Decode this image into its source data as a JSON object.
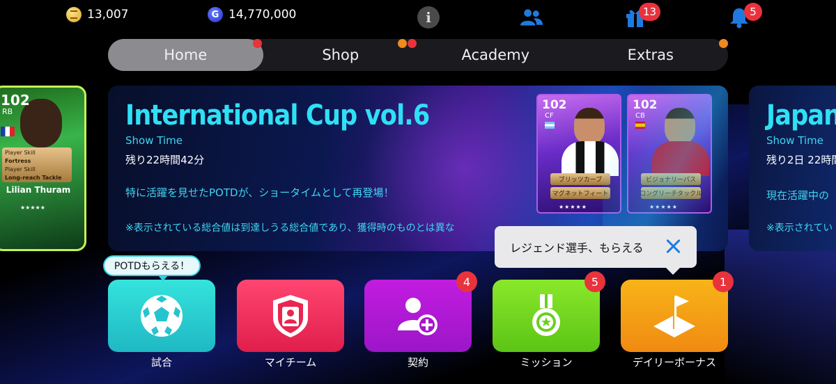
{
  "currencies": {
    "coins": "13,007",
    "gp": "14,770,000",
    "gp_icon_letter": "G"
  },
  "top_icons": {
    "info": "i",
    "gift_badge": "13",
    "bell_badge": "5"
  },
  "nav": {
    "tabs": [
      {
        "label": "Home",
        "active": true
      },
      {
        "label": "Shop",
        "active": false
      },
      {
        "label": "Academy",
        "active": false
      },
      {
        "label": "Extras",
        "active": false
      }
    ]
  },
  "left_card": {
    "rating": "102",
    "position": "RB",
    "skill_1_title": "Player Skill",
    "skill_1": "Fortress",
    "skill_2_title": "Player Skill",
    "skill_2": "Long-reach Tackle",
    "player_name": "Lilian Thuram",
    "stars": "★★★★★"
  },
  "main_card": {
    "title": "International Cup vol.6",
    "subtitle": "Show Time",
    "time_left": "残り22時間42分",
    "description": "特に活躍を見せたPOTDが、ショータイムとして再登場！",
    "note": "※表示されている総合値は到達しうる総合値であり、獲得時のものとは異な",
    "players": [
      {
        "rating": "102",
        "position": "CF",
        "skill_1": "ブリッツカーブ",
        "skill_2": "マグネットフィート",
        "stars": "★★★★★"
      },
      {
        "rating": "102",
        "position": "CB",
        "skill_1": "ビジョナリーパス",
        "skill_2": "ロングリーチタックル",
        "stars": "★★★★★"
      }
    ]
  },
  "right_card": {
    "title": "Japan",
    "subtitle": "Show Time",
    "time_left": "残り2日 22時間",
    "description": "現在活躍中の",
    "note": "※表示されてい"
  },
  "tooltips": {
    "potd": "POTDもらえる！",
    "legend": "レジェンド選手、もらえる"
  },
  "actions": [
    {
      "label": "試合",
      "badge": ""
    },
    {
      "label": "マイチーム",
      "badge": ""
    },
    {
      "label": "契約",
      "badge": "4"
    },
    {
      "label": "ミッション",
      "badge": "5"
    },
    {
      "label": "デイリーボーナス",
      "badge": "1"
    }
  ],
  "colors": {
    "accent_cyan": "#2fe0f5",
    "badge_red": "#e8333d",
    "notify_orange": "#f08a1e",
    "icon_blue": "#1f7ae0"
  }
}
